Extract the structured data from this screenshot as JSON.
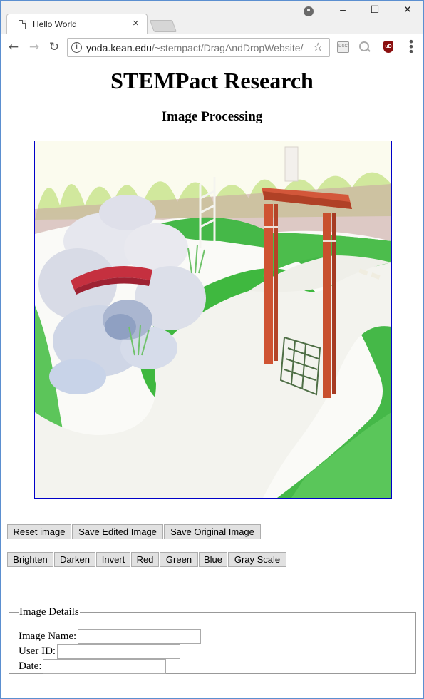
{
  "browser": {
    "tab_title": "Hello World",
    "tab_close": "×",
    "window_controls": {
      "minimize": "–",
      "maximize": "☐",
      "close": "✕"
    },
    "url_host": "yoda.kean.edu",
    "url_path": "/~stempact/DragAndDropWebsite/",
    "nav": {
      "back": "←",
      "forward": "→",
      "reload": "↻"
    },
    "star": "☆",
    "extensions": [
      "dsc-icon",
      "search-lens-icon",
      "ublock-icon"
    ],
    "ublock_label": "uD",
    "menu": "⋮"
  },
  "page": {
    "title": "STEMPact Research",
    "subtitle": "Image Processing"
  },
  "actions": {
    "reset": "Reset image",
    "save_edited": "Save Edited Image",
    "save_original": "Save Original Image"
  },
  "filters": {
    "brighten": "Brighten",
    "darken": "Darken",
    "invert": "Invert",
    "red": "Red",
    "green": "Green",
    "blue": "Blue",
    "grayscale": "Gray Scale"
  },
  "details": {
    "legend": "Image Details",
    "image_name_label": "Image Name:",
    "image_name_value": "",
    "user_id_label": "User ID:",
    "user_id_value": "",
    "date_label": "Date:",
    "date_value": ""
  },
  "colors": {
    "canvas_border": "#0000c8",
    "lawn": "#3fb83f",
    "path": "#f3f3ee",
    "arbor": "#c8502e",
    "bridge": "#c5303f"
  }
}
